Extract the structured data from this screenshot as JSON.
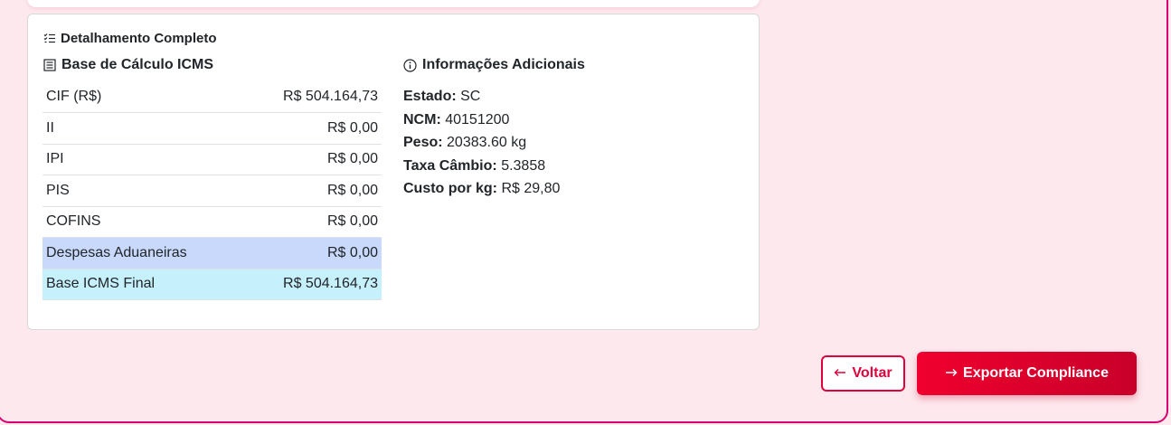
{
  "card": {
    "title": "Detalhamento Completo",
    "title_icon": "list-icon"
  },
  "base_calculo": {
    "title": "Base de Cálculo ICMS",
    "title_icon": "document-icon",
    "rows": [
      {
        "label": "CIF (R$)",
        "value": "R$ 504.164,73"
      },
      {
        "label": "II",
        "value": "R$ 0,00"
      },
      {
        "label": "IPI",
        "value": "R$ 0,00"
      },
      {
        "label": "PIS",
        "value": "R$ 0,00"
      },
      {
        "label": "COFINS",
        "value": "R$ 0,00"
      },
      {
        "label": "Despesas Aduaneiras",
        "value": "R$ 0,00"
      },
      {
        "label": "Base ICMS Final",
        "value": "R$ 504.164,73"
      }
    ]
  },
  "info": {
    "title": "Informações Adicionais",
    "title_icon": "info-circle-icon",
    "items": [
      {
        "label": "Estado:",
        "value": "SC"
      },
      {
        "label": "NCM:",
        "value": "40151200"
      },
      {
        "label": "Peso:",
        "value": "20383.60 kg"
      },
      {
        "label": "Taxa Câmbio:",
        "value": "5.3858"
      },
      {
        "label": "Custo por kg:",
        "value": "R$ 29,80"
      }
    ]
  },
  "actions": {
    "back_label": "Voltar",
    "export_label": "Exportar Compliance"
  },
  "colors": {
    "accent": "#e0003c",
    "row_highlight_blue": "#c8d9fb",
    "row_highlight_cyan": "#c6f0fb",
    "page_bg": "#fde8ee"
  }
}
